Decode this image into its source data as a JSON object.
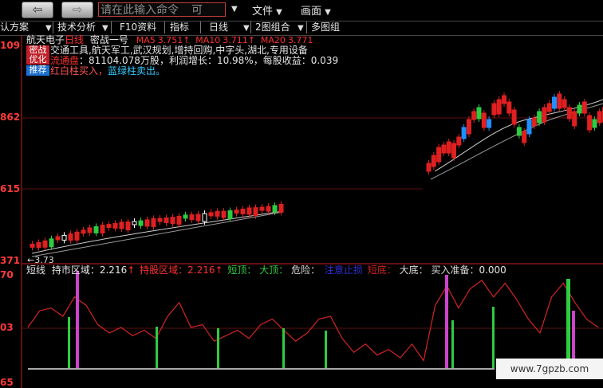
{
  "toolbar": {
    "back_icon": "back-arrow-icon",
    "forward_icon": "forward-arrow-icon",
    "command_placeholder": "请在此输入命令",
    "command_suffix": "可",
    "menu_file": "文件",
    "menu_view": "画面"
  },
  "tabs": {
    "scheme": "认方案",
    "tech": "技术分析",
    "f10": "F10资料",
    "indicator": "指标",
    "daily": "日线",
    "combo2": "2图组合",
    "multi": "多图组"
  },
  "stock": {
    "name": "航天电子",
    "period": "日线",
    "indicator": "密战一号",
    "ma5_label": "MA5",
    "ma5_value": "3.751",
    "ma10_label": "MA10",
    "ma10_value": "3.711",
    "ma20_label": "MA20",
    "ma20_value": "3.771",
    "concepts": "交通工具,航天军工,武汉规划,增持回购,中字头,湖北,专用设备",
    "float_label": "流通盘",
    "float_value": "81104.078万股",
    "profit_growth": "利润增长：10.98%",
    "eps": "每股收益：0.039",
    "hint_red": "红白柱买入，",
    "hint_blue": "蓝绿柱卖出。"
  },
  "badges": {
    "line1": "密战",
    "line2": "优化",
    "recommend": "推荐"
  },
  "price_axis": {
    "top": "109",
    "mid": "862",
    "low": "615",
    "bottom": "371",
    "marker": "←3.73"
  },
  "lower_panel": {
    "name": "短线",
    "hold_label": "持市区域：",
    "hold_value": "2.216",
    "keep_label": "持股区域：",
    "keep_value": "2.216",
    "short_label": "短顶：",
    "big_top": "大顶：",
    "danger": "危险：",
    "stop": "注意止损",
    "short_bottom": "短底：",
    "big_bottom": "大底：",
    "buy_ready": "买入准备：",
    "buy_ready_value": "0.000",
    "axis_top": "70",
    "axis_mid": "03",
    "axis_bottom": "65"
  },
  "watermark": "www.7gpzb.com",
  "colors": {
    "up": "#e02020",
    "down_green": "#2ecc40",
    "down_blue": "#1e90ff",
    "purple": "#cc44cc",
    "axis_red": "#c81e1e"
  },
  "chart_data": {
    "type": "line",
    "title": "",
    "series": [
      {
        "name": "短线",
        "values": [
          1.5,
          2.1,
          2.2,
          1.9,
          2.6,
          2.3,
          1.6,
          1.3,
          1.5,
          1.2,
          1.4,
          1.1,
          1.9,
          2.4,
          1.5,
          1.6,
          1.0,
          1.2,
          1.4,
          1.1,
          1.6,
          1.8,
          1.4,
          1.0,
          1.3,
          1.8,
          1.9,
          1.1,
          0.6,
          0.9,
          0.5,
          0.7,
          0.4,
          0.9,
          0.3,
          2.3,
          3.0,
          2.2,
          2.9,
          3.2,
          2.6,
          3.1,
          2.5,
          1.8,
          1.3,
          2.6,
          3.1,
          2.4,
          1.8,
          1.5
        ]
      }
    ]
  }
}
